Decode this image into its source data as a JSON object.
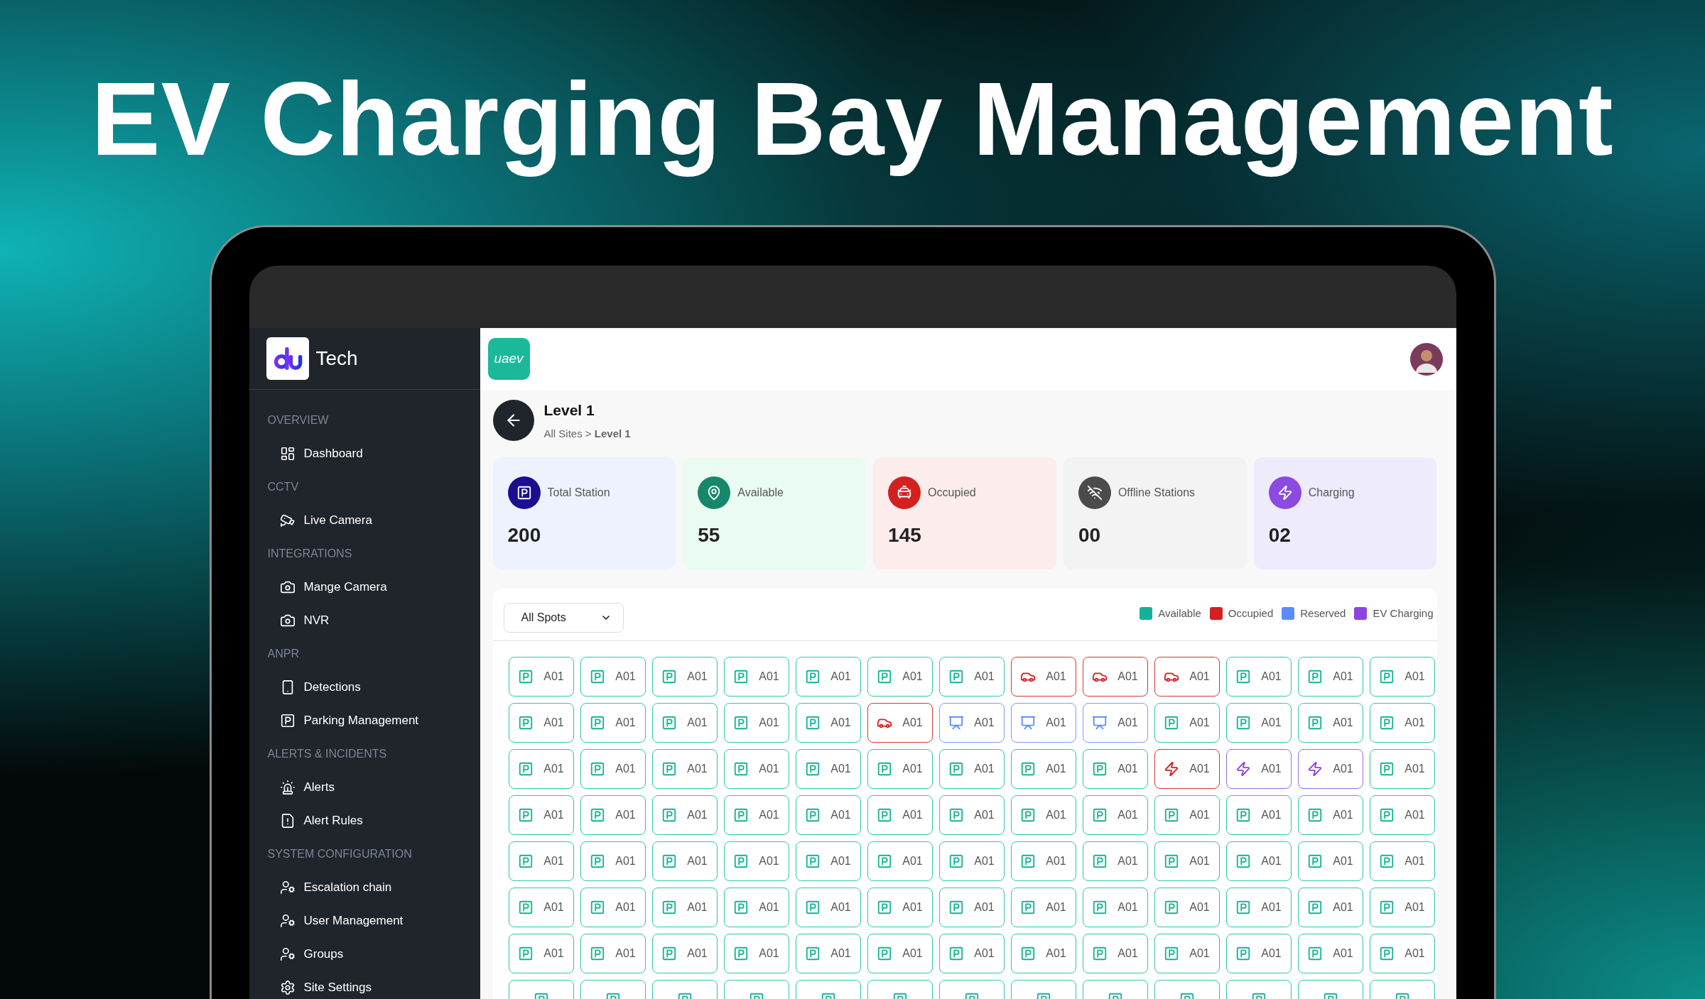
{
  "headline": "EV Charging Bay Management",
  "sidebar": {
    "brand": "Tech",
    "sections": [
      {
        "title": "OVERVIEW",
        "items": [
          {
            "label": "Dashboard"
          }
        ]
      },
      {
        "title": "CCTV",
        "items": [
          {
            "label": "Live Camera"
          }
        ]
      },
      {
        "title": "INTEGRATIONS",
        "items": [
          {
            "label": "Mange Camera"
          },
          {
            "label": "NVR"
          }
        ]
      },
      {
        "title": "ANPR",
        "items": [
          {
            "label": "Detections"
          },
          {
            "label": "Parking Management"
          }
        ]
      },
      {
        "title": "ALERTS & INCIDENTS",
        "items": [
          {
            "label": "Alerts"
          },
          {
            "label": "Alert Rules"
          }
        ]
      },
      {
        "title": "SYSTEM CONFIGURATION",
        "items": [
          {
            "label": "Escalation chain"
          },
          {
            "label": "User Management"
          },
          {
            "label": "Groups"
          },
          {
            "label": "Site Settings"
          }
        ]
      }
    ]
  },
  "header": {
    "logo": "uaev"
  },
  "page": {
    "title": "Level 1",
    "breadcrumb": "All Sites > **Level 1**"
  },
  "stats": [
    {
      "kind": "total",
      "label": "Total Station",
      "value": "200"
    },
    {
      "kind": "available",
      "label": "Available",
      "value": "55"
    },
    {
      "kind": "occupied",
      "label": "Occupied",
      "value": "145"
    },
    {
      "kind": "offline",
      "label": "Offline Stations",
      "value": "00"
    },
    {
      "kind": "charging",
      "label": "Charging",
      "value": "02"
    }
  ],
  "filter": {
    "value": "All Spots"
  },
  "legend": [
    {
      "label": "Available",
      "color": "#10b39a"
    },
    {
      "label": "Occupied",
      "color": "#d42020"
    },
    {
      "label": "Reserved",
      "color": "#5b8cff"
    },
    {
      "label": "EV Charging",
      "color": "#8e44e0"
    }
  ],
  "spots": [
    [
      {
        "kind": "available",
        "label": "A01"
      },
      {
        "kind": "available",
        "label": "A01"
      },
      {
        "kind": "available",
        "label": "A01"
      },
      {
        "kind": "available",
        "label": "A01"
      },
      {
        "kind": "available",
        "label": "A01"
      },
      {
        "kind": "available",
        "label": "A01"
      },
      {
        "kind": "available",
        "label": "A01"
      },
      {
        "kind": "occupied",
        "label": "A01"
      },
      {
        "kind": "occupied",
        "label": "A01"
      },
      {
        "kind": "occupied",
        "label": "A01"
      },
      {
        "kind": "available",
        "label": "A01"
      },
      {
        "kind": "available",
        "label": "A01"
      },
      {
        "kind": "available",
        "label": "A01"
      }
    ],
    [
      {
        "kind": "available",
        "label": "A01"
      },
      {
        "kind": "available",
        "label": "A01"
      },
      {
        "kind": "available",
        "label": "A01"
      },
      {
        "kind": "available",
        "label": "A01"
      },
      {
        "kind": "available",
        "label": "A01"
      },
      {
        "kind": "occupied",
        "label": "A01"
      },
      {
        "kind": "reserved",
        "label": "A01"
      },
      {
        "kind": "reserved",
        "label": "A01"
      },
      {
        "kind": "reserved",
        "label": "A01"
      },
      {
        "kind": "available",
        "label": "A01"
      },
      {
        "kind": "available",
        "label": "A01"
      },
      {
        "kind": "available",
        "label": "A01"
      },
      {
        "kind": "available",
        "label": "A01"
      }
    ],
    [
      {
        "kind": "available",
        "label": "A01"
      },
      {
        "kind": "available",
        "label": "A01"
      },
      {
        "kind": "available",
        "label": "A01"
      },
      {
        "kind": "available",
        "label": "A01"
      },
      {
        "kind": "available",
        "label": "A01"
      },
      {
        "kind": "available",
        "label": "A01"
      },
      {
        "kind": "available",
        "label": "A01"
      },
      {
        "kind": "available",
        "label": "A01"
      },
      {
        "kind": "available",
        "label": "A01"
      },
      {
        "kind": "fault",
        "label": "A01"
      },
      {
        "kind": "charging",
        "label": "A01"
      },
      {
        "kind": "charging",
        "label": "A01"
      },
      {
        "kind": "available",
        "label": "A01"
      }
    ],
    [
      {
        "kind": "available",
        "label": "A01"
      },
      {
        "kind": "available",
        "label": "A01"
      },
      {
        "kind": "available",
        "label": "A01"
      },
      {
        "kind": "available",
        "label": "A01"
      },
      {
        "kind": "available",
        "label": "A01"
      },
      {
        "kind": "available",
        "label": "A01"
      },
      {
        "kind": "available",
        "label": "A01"
      },
      {
        "kind": "available",
        "label": "A01"
      },
      {
        "kind": "available",
        "label": "A01"
      },
      {
        "kind": "available",
        "label": "A01"
      },
      {
        "kind": "available",
        "label": "A01"
      },
      {
        "kind": "available",
        "label": "A01"
      },
      {
        "kind": "available",
        "label": "A01"
      }
    ],
    [
      {
        "kind": "available",
        "label": "A01"
      },
      {
        "kind": "available",
        "label": "A01"
      },
      {
        "kind": "available",
        "label": "A01"
      },
      {
        "kind": "available",
        "label": "A01"
      },
      {
        "kind": "available",
        "label": "A01"
      },
      {
        "kind": "available",
        "label": "A01"
      },
      {
        "kind": "available",
        "label": "A01"
      },
      {
        "kind": "available",
        "label": "A01"
      },
      {
        "kind": "available",
        "label": "A01"
      },
      {
        "kind": "available",
        "label": "A01"
      },
      {
        "kind": "available",
        "label": "A01"
      },
      {
        "kind": "available",
        "label": "A01"
      },
      {
        "kind": "available",
        "label": "A01"
      }
    ],
    [
      {
        "kind": "available",
        "label": "A01"
      },
      {
        "kind": "available",
        "label": "A01"
      },
      {
        "kind": "available",
        "label": "A01"
      },
      {
        "kind": "available",
        "label": "A01"
      },
      {
        "kind": "available",
        "label": "A01"
      },
      {
        "kind": "available",
        "label": "A01"
      },
      {
        "kind": "available",
        "label": "A01"
      },
      {
        "kind": "available",
        "label": "A01"
      },
      {
        "kind": "available",
        "label": "A01"
      },
      {
        "kind": "available",
        "label": "A01"
      },
      {
        "kind": "available",
        "label": "A01"
      },
      {
        "kind": "available",
        "label": "A01"
      },
      {
        "kind": "available",
        "label": "A01"
      }
    ],
    [
      {
        "kind": "available",
        "label": "A01"
      },
      {
        "kind": "available",
        "label": "A01"
      },
      {
        "kind": "available",
        "label": "A01"
      },
      {
        "kind": "available",
        "label": "A01"
      },
      {
        "kind": "available",
        "label": "A01"
      },
      {
        "kind": "available",
        "label": "A01"
      },
      {
        "kind": "available",
        "label": "A01"
      },
      {
        "kind": "available",
        "label": "A01"
      },
      {
        "kind": "available",
        "label": "A01"
      },
      {
        "kind": "available",
        "label": "A01"
      },
      {
        "kind": "available",
        "label": "A01"
      },
      {
        "kind": "available",
        "label": "A01"
      },
      {
        "kind": "available",
        "label": "A01"
      }
    ],
    [
      {
        "kind": "available"
      },
      {
        "kind": "available"
      },
      {
        "kind": "available"
      },
      {
        "kind": "available"
      },
      {
        "kind": "available"
      },
      {
        "kind": "available"
      },
      {
        "kind": "available"
      },
      {
        "kind": "available"
      },
      {
        "kind": "available"
      },
      {
        "kind": "available"
      },
      {
        "kind": "available"
      },
      {
        "kind": "available"
      },
      {
        "kind": "available"
      }
    ]
  ]
}
